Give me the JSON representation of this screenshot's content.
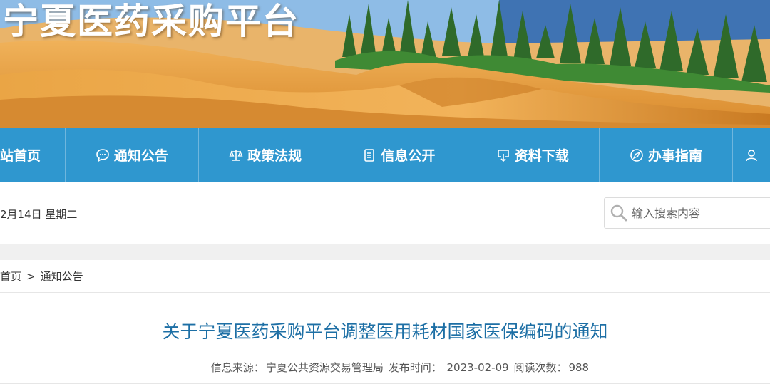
{
  "banner": {
    "site_title": "宁夏医药采购平台"
  },
  "nav": {
    "items": [
      {
        "label": "站首页",
        "icon": "home-icon"
      },
      {
        "label": "通知公告",
        "icon": "chat-bubble-icon"
      },
      {
        "label": "政策法规",
        "icon": "scales-icon"
      },
      {
        "label": "信息公开",
        "icon": "document-list-icon"
      },
      {
        "label": "资料下载",
        "icon": "download-icon"
      },
      {
        "label": "办事指南",
        "icon": "compass-icon"
      },
      {
        "label": "",
        "icon": "user-icon"
      }
    ],
    "color": "#2f97cf"
  },
  "date": {
    "text": "2月14日 星期二"
  },
  "search": {
    "placeholder": "输入搜索内容"
  },
  "breadcrumb": {
    "home": "首页",
    "separator": ">",
    "current": "通知公告"
  },
  "article": {
    "title": "关于宁夏医药采购平台调整医用耗材国家医保编码的通知",
    "meta": {
      "source_label": "信息来源：",
      "source": "宁夏公共资源交易管理局",
      "date_label": "发布时间：",
      "date": "2023-02-09",
      "views_label": "阅读次数：",
      "views": "988"
    },
    "title_color": "#1d6fa5"
  }
}
